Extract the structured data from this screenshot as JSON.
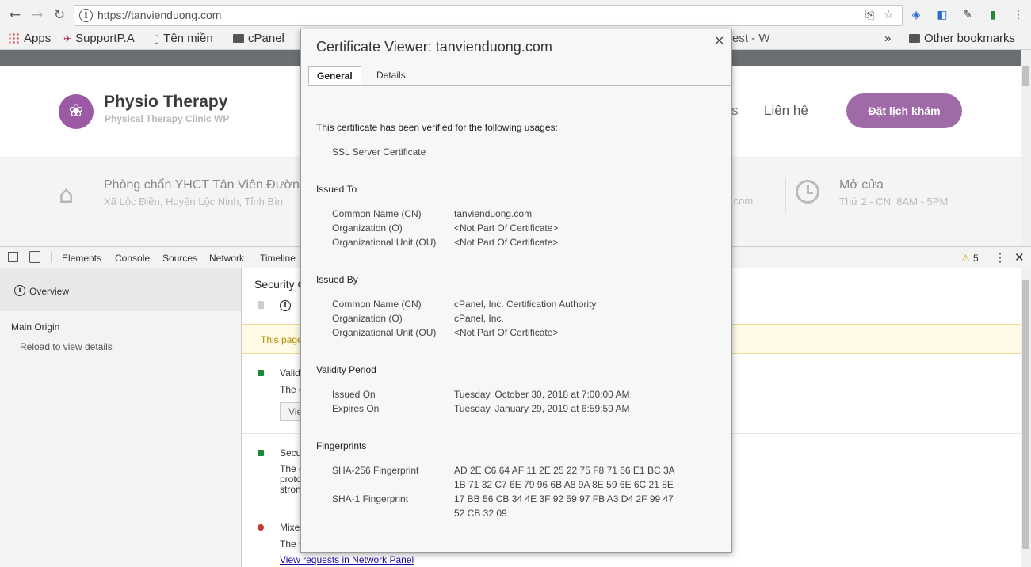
{
  "browser": {
    "url": "https://tanvienduong.com",
    "bookmarks": [
      "Apps",
      "SupportP.A",
      "Tên miền",
      "cPanel",
      "est - W",
      "Other bookmarks"
    ],
    "more_bookmarks": "»"
  },
  "site": {
    "logo_title": "Physio Therapy",
    "logo_subtitle": "Physical Therapy Clinic WP",
    "nav_partial": "s",
    "nav_contact": "Liên hệ",
    "cta_button": "Đặt lịch khám",
    "clinic_name": "Phòng chẩn YHCT Tân Viên Đườn",
    "clinic_address": "Xã Lộc Điền, Huyện Lộc Ninh, Tỉnh Bìn",
    "email_partial": ".com",
    "hours_title": "Mở cửa",
    "hours_text": "Thứ 2 - CN: 8AM - 5PM"
  },
  "devtools": {
    "tabs": [
      "Elements",
      "Console",
      "Sources",
      "Network",
      "Timeline"
    ],
    "warning_count": "5",
    "sidebar": {
      "overview": "Overview",
      "main_origin": "Main Origin",
      "reload_hint": "Reload to view details"
    },
    "panel": {
      "heading_partial": "Security C",
      "banner_partial": "This page",
      "row1_title": "Valid",
      "row1_text": "The c",
      "row1_button": "Vie",
      "row2_title": "Secu",
      "row2_text": [
        "The c",
        "proto",
        "stron"
      ],
      "row3_title": "Mixe",
      "row3_text": "The s",
      "link": "View requests in Network Panel"
    },
    "colors": {
      "secure": "#1a8a3a",
      "mixed": "#c5392f",
      "banner_bg": "#fffbe6"
    }
  },
  "dialog": {
    "title": "Certificate Viewer: tanvienduong.com",
    "close": "×",
    "tabs": [
      "General",
      "Details"
    ],
    "verified_text": "This certificate has been verified for the following usages:",
    "usage": "SSL Server Certificate",
    "issued_to": {
      "heading": "Issued To",
      "rows": [
        {
          "label": "Common Name (CN)",
          "value": "tanvienduong.com"
        },
        {
          "label": "Organization (O)",
          "value": "<Not Part Of Certificate>"
        },
        {
          "label": "Organizational Unit (OU)",
          "value": "<Not Part Of Certificate>"
        }
      ]
    },
    "issued_by": {
      "heading": "Issued By",
      "rows": [
        {
          "label": "Common Name (CN)",
          "value": "cPanel, Inc. Certification Authority"
        },
        {
          "label": "Organization (O)",
          "value": "cPanel, Inc."
        },
        {
          "label": "Organizational Unit (OU)",
          "value": "<Not Part Of Certificate>"
        }
      ]
    },
    "validity": {
      "heading": "Validity Period",
      "rows": [
        {
          "label": "Issued On",
          "value": "Tuesday, October 30, 2018 at 7:00:00 AM"
        },
        {
          "label": "Expires On",
          "value": "Tuesday, January 29, 2019 at 6:59:59 AM"
        }
      ]
    },
    "fingerprints": {
      "heading": "Fingerprints",
      "sha256_label": "SHA-256 Fingerprint",
      "sha256_lines": [
        "AD 2E C6 64 AF 11 2E 25 22 75 F8 71 66 E1 BC 3A",
        "1B 71 32 C7 6E 79 96 6B A8 9A 8E 59 6E 6C 21 8E"
      ],
      "sha1_label": "SHA-1 Fingerprint",
      "sha1_lines": [
        "17 BB 56 CB 34 4E 3F 92 59 97 FB A3 D4 2F 99 47",
        "52 CB 32 09"
      ]
    }
  }
}
